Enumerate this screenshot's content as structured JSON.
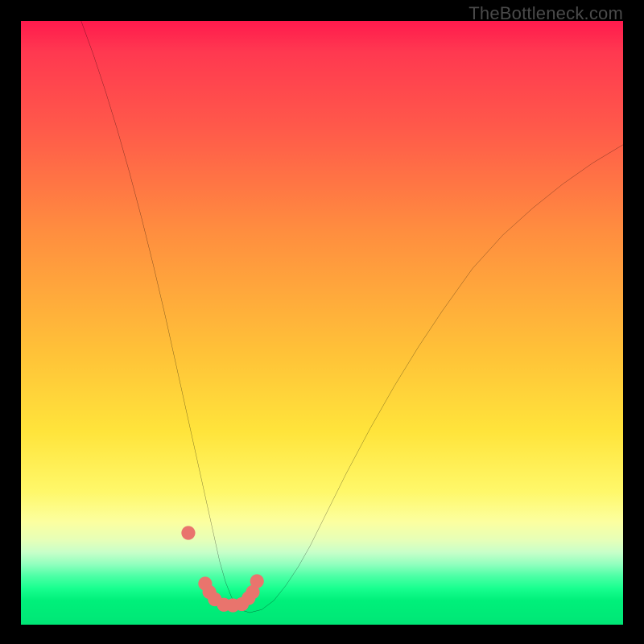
{
  "watermark": "TheBottleneck.com",
  "chart_data": {
    "type": "line",
    "title": "",
    "xlabel": "",
    "ylabel": "",
    "xlim": [
      0,
      100
    ],
    "ylim": [
      0,
      100
    ],
    "grid": false,
    "series": [
      {
        "name": "curve",
        "x": [
          10,
          12,
          14,
          16,
          18,
          20,
          22,
          24,
          26,
          28,
          30,
          31,
          32,
          33,
          34,
          35,
          36,
          37,
          38,
          40,
          42,
          44,
          46,
          48,
          50,
          54,
          58,
          62,
          66,
          70,
          75,
          80,
          85,
          90,
          95,
          100
        ],
        "y": [
          100,
          94.5,
          88.5,
          82,
          75,
          67.5,
          59.5,
          51,
          42,
          33,
          24,
          19.5,
          15,
          10.5,
          7,
          4.5,
          3,
          2.3,
          2,
          2.5,
          4,
          6.5,
          9.5,
          13,
          17,
          25,
          32.5,
          39.5,
          46,
          52,
          59,
          64.5,
          69,
          73,
          76.5,
          79.5
        ]
      }
    ],
    "markers": {
      "name": "dots",
      "x": [
        27.8,
        30.6,
        31.3,
        32.2,
        33.7,
        35.2,
        36.7,
        37.8,
        38.5,
        39.2
      ],
      "y": [
        15.2,
        6.8,
        5.4,
        4.2,
        3.3,
        3.2,
        3.4,
        4.4,
        5.4,
        7.2
      ]
    }
  }
}
